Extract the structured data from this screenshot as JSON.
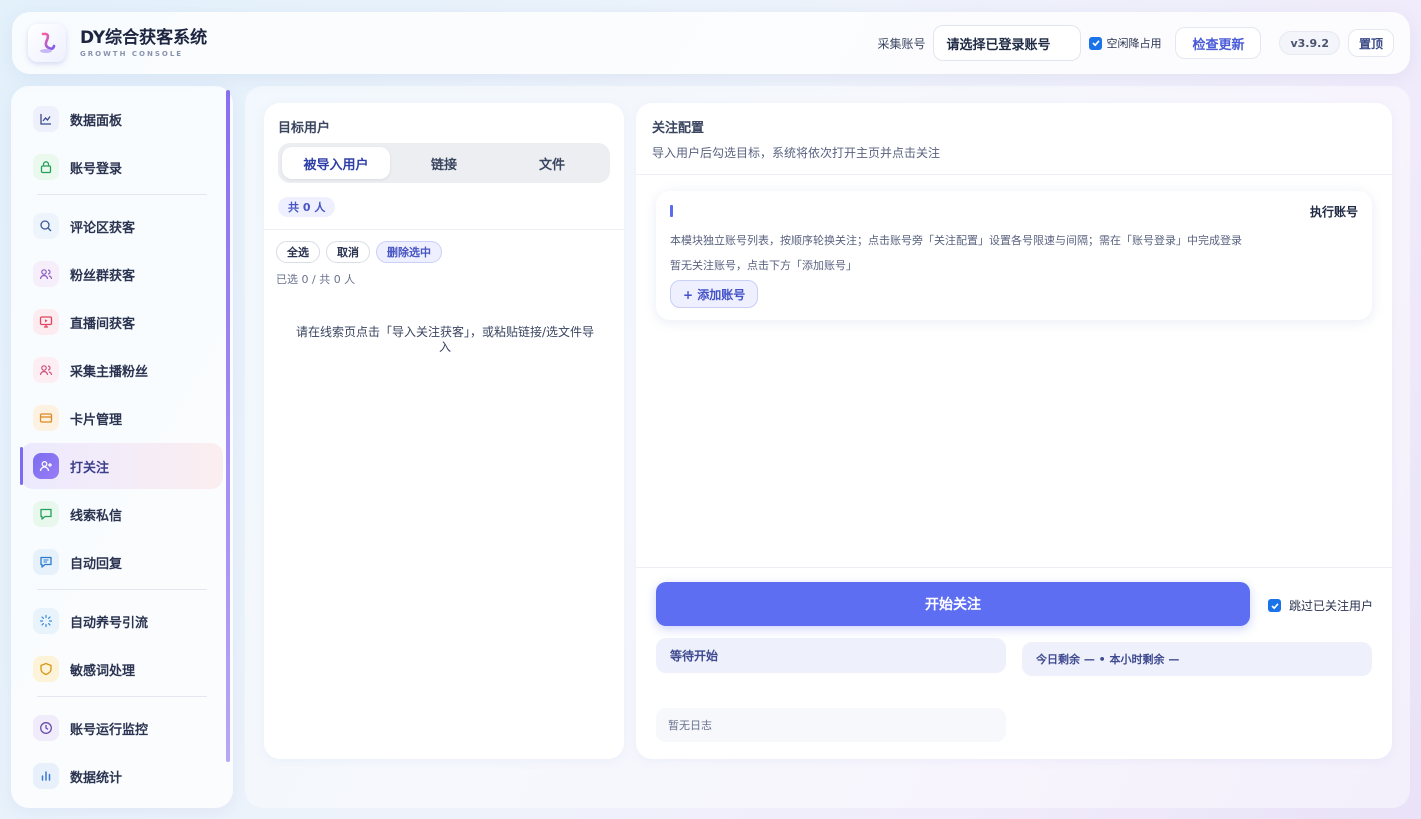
{
  "header": {
    "title": "DY综合获客系统",
    "subtitle": "GROWTH CONSOLE",
    "account_label": "采集账号",
    "account_select": "请选择已登录账号",
    "idle_label": "空闲降占用",
    "update_label": "检查更新",
    "version": "v3.9.2",
    "top_label": "置顶"
  },
  "sidebar": {
    "items": [
      {
        "label": "数据面板",
        "icon": "chart-icon"
      },
      {
        "label": "账号登录",
        "icon": "lock-icon"
      },
      {
        "label": "评论区获客",
        "icon": "search-icon"
      },
      {
        "label": "粉丝群获客",
        "icon": "users-icon"
      },
      {
        "label": "直播间获客",
        "icon": "monitor-icon"
      },
      {
        "label": "采集主播粉丝",
        "icon": "users-icon"
      },
      {
        "label": "卡片管理",
        "icon": "card-icon"
      },
      {
        "label": "打关注",
        "icon": "user-plus-icon"
      },
      {
        "label": "线索私信",
        "icon": "message-icon"
      },
      {
        "label": "自动回复",
        "icon": "reply-icon"
      },
      {
        "label": "自动养号引流",
        "icon": "loader-icon"
      },
      {
        "label": "敏感词处理",
        "icon": "shield-icon"
      },
      {
        "label": "账号运行监控",
        "icon": "clock-icon"
      },
      {
        "label": "数据统计",
        "icon": "bar-chart-icon"
      }
    ],
    "active_index": 7
  },
  "target": {
    "title": "目标用户",
    "tabs": [
      "被导入用户",
      "链接",
      "文件"
    ],
    "count": "共 0 人",
    "select_all": "全选",
    "cancel": "取消",
    "delete_selected": "删除选中",
    "selected_info": "已选 0 / 共 0 人",
    "empty_hint": "请在线索页点击「导入关注获客」，或粘贴链接/选文件导入"
  },
  "config": {
    "title": "关注配置",
    "subtitle": "导入用户后勾选目标，系统将依次打开主页并点击关注",
    "exec_label": "执行账号",
    "exec_desc": "本模块独立账号列表，按顺序轮换关注；点击账号旁「关注配置」设置各号限速与间隔；需在「账号登录」中完成登录",
    "exec_empty": "暂无关注账号，点击下方「添加账号」",
    "add_account": "+ 添加账号",
    "start_label": "开始关注",
    "skip_label": "跳过已关注用户",
    "status": "等待开始",
    "quota": "今日剩余 — • 本小时剩余 —",
    "log": "暂无日志"
  },
  "colors": {
    "accent": "#5e6ef2",
    "active_nav": "#7a6ef0"
  }
}
